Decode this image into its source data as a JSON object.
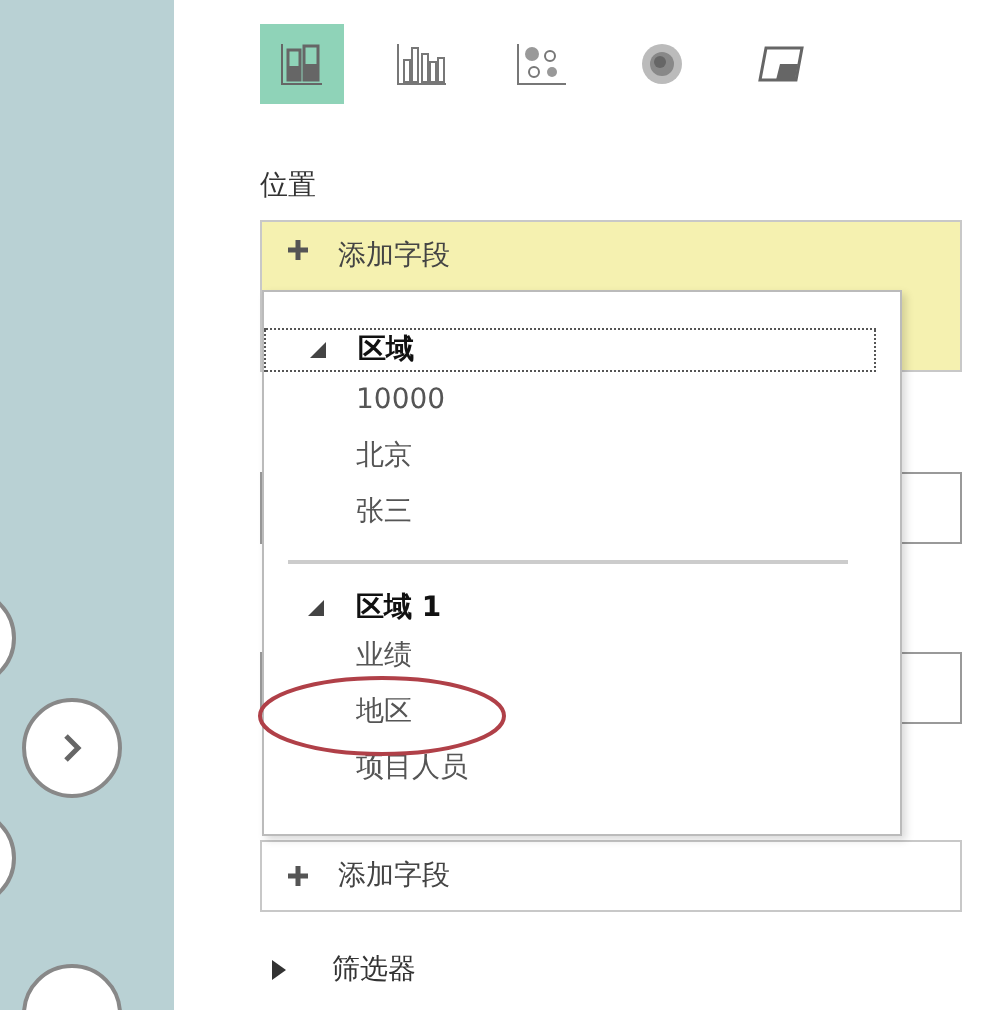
{
  "layer_types": [
    {
      "selected": true
    },
    {
      "selected": false
    },
    {
      "selected": false
    },
    {
      "selected": false
    },
    {
      "selected": false
    }
  ],
  "location": {
    "label": "位置",
    "add_field": "添加字段"
  },
  "field_popup": {
    "groups": [
      {
        "name": "区域",
        "expanded": true,
        "focused": true,
        "items": [
          "10000",
          "北京",
          "张三"
        ]
      },
      {
        "name": "区域 1",
        "expanded": true,
        "focused": false,
        "items": [
          "业绩",
          "地区",
          "项目人员"
        ]
      }
    ]
  },
  "lower_field": {
    "add_field": "添加字段"
  },
  "filters": {
    "label": "筛选器",
    "expanded": false
  }
}
